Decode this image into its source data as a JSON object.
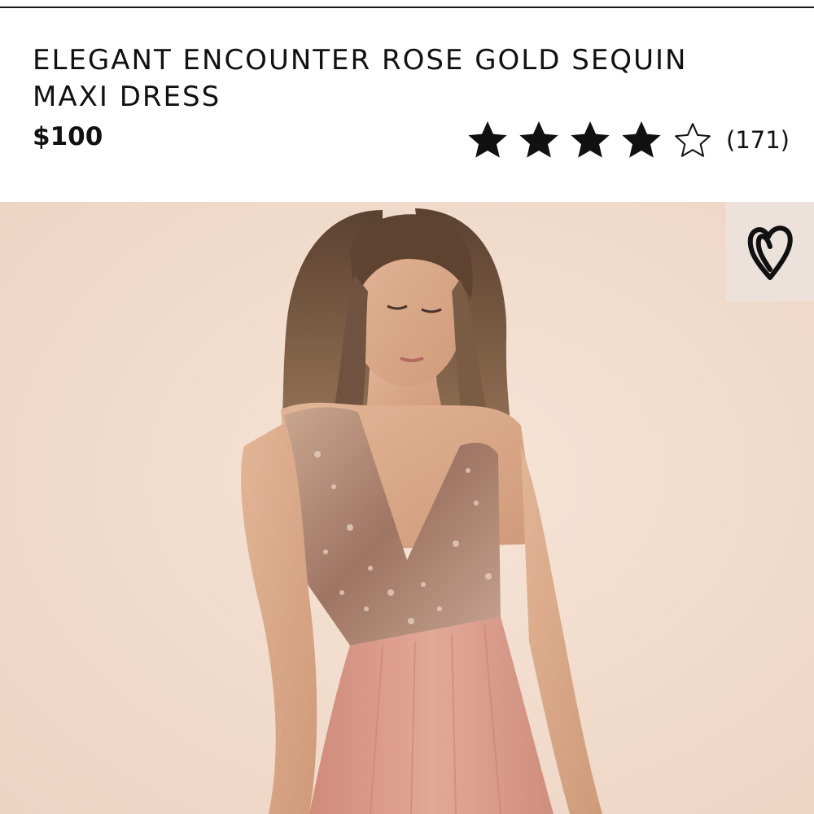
{
  "product": {
    "title": "ELEGANT ENCOUNTER ROSE GOLD SEQUIN MAXI DRESS",
    "price": "$100",
    "rating": {
      "stars_filled": 4,
      "stars_total": 5,
      "review_count": "(171)"
    }
  },
  "icons": {
    "star_filled": "star-filled-icon",
    "star_empty": "star-outline-icon",
    "favorite": "heart-icon"
  },
  "colors": {
    "text": "#111111",
    "backdrop": "#f2dccd",
    "skirt": "#d99a8a",
    "sequin": "#b58a72"
  }
}
